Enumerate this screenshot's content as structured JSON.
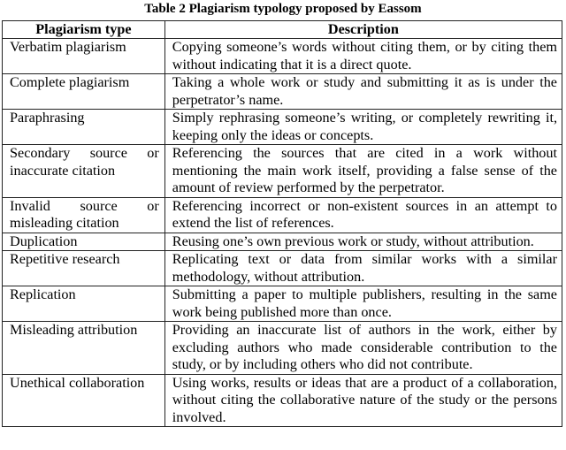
{
  "caption": "Table 2 Plagiarism typology proposed by Eassom",
  "table": {
    "headers": [
      "Plagiarism type",
      "Description"
    ],
    "rows": [
      {
        "type": "Verbatim plagiarism",
        "description": "Copying someone’s words without citing them, or by citing them without indicating that it is a direct quote."
      },
      {
        "type": "Complete plagiarism",
        "description": "Taking a whole work or study and submitting it as is under the perpetrator’s name."
      },
      {
        "type": "Paraphrasing",
        "description": "Simply rephrasing someone’s writing, or completely rewriting it, keeping only the ideas or concepts."
      },
      {
        "type": "Secondary source or inaccurate citation",
        "description": "Referencing the sources that are cited in a work without mentioning the main work itself, providing a false sense of the amount of review performed by the perpetrator."
      },
      {
        "type": "Invalid source or misleading citation",
        "description": "Referencing incorrect or non-existent sources in an attempt to extend the list of references."
      },
      {
        "type": "Duplication",
        "description": "Reusing one’s own previous work or study, without attribution."
      },
      {
        "type": "Repetitive research",
        "description": "Replicating text or data from similar works with a similar methodology, without attribution."
      },
      {
        "type": "Replication",
        "description": "Submitting a paper to multiple publishers, resulting in the same work being published more than once."
      },
      {
        "type": "Misleading attribution",
        "description": "Providing an inaccurate list of authors in the work, either by excluding authors who made considerable contribution to the study, or by including others who did not contribute."
      },
      {
        "type": "Unethical collaboration",
        "description": "Using works, results or ideas that are a product of a collaboration, without citing the collaborative nature of the study or the persons involved."
      }
    ]
  }
}
